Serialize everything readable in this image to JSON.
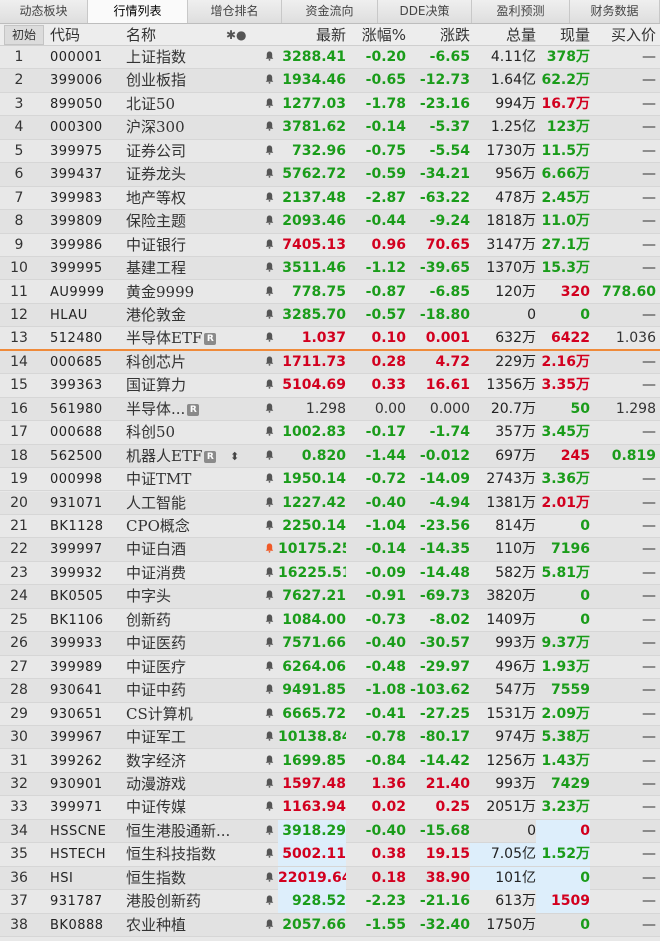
{
  "tabs": [
    "动态板块",
    "行情列表",
    "增仓排名",
    "资金流向",
    "DDE决策",
    "盈利预测",
    "财务数据"
  ],
  "active_tab": 1,
  "header": {
    "init_button": "初始",
    "code": "代码",
    "name": "名称",
    "icons": "✱●",
    "latest": "最新",
    "pct": "涨幅%",
    "chg": "涨跌",
    "volume": "总量",
    "current": "现量",
    "bid": "买入价"
  },
  "colors": {
    "up": "#d2001f",
    "down": "#1a9c1a",
    "separator": "#ef8a3a",
    "highlight": "#ddeefb"
  },
  "rows": [
    {
      "no": "1",
      "code": "000001",
      "name": "上证指数",
      "latest": "3288.41",
      "pct": "-0.20",
      "chg": "-6.65",
      "vol": "4.11亿",
      "cur": "378万",
      "bid": "—",
      "dir": "dn",
      "cur_dir": "dn"
    },
    {
      "no": "2",
      "code": "399006",
      "name": "创业板指",
      "latest": "1934.46",
      "pct": "-0.65",
      "chg": "-12.73",
      "vol": "1.64亿",
      "cur": "62.2万",
      "bid": "—",
      "dir": "dn",
      "cur_dir": "dn"
    },
    {
      "no": "3",
      "code": "899050",
      "name": "北证50",
      "latest": "1277.03",
      "pct": "-1.78",
      "chg": "-23.16",
      "vol": "994万",
      "cur": "16.7万",
      "bid": "—",
      "dir": "dn",
      "cur_dir": "up"
    },
    {
      "no": "4",
      "code": "000300",
      "name": "沪深300",
      "latest": "3781.62",
      "pct": "-0.14",
      "chg": "-5.37",
      "vol": "1.25亿",
      "cur": "123万",
      "bid": "—",
      "dir": "dn",
      "cur_dir": "dn"
    },
    {
      "no": "5",
      "code": "399975",
      "name": "证券公司",
      "latest": "732.96",
      "pct": "-0.75",
      "chg": "-5.54",
      "vol": "1730万",
      "cur": "11.5万",
      "bid": "—",
      "dir": "dn",
      "cur_dir": "dn"
    },
    {
      "no": "6",
      "code": "399437",
      "name": "证券龙头",
      "latest": "5762.72",
      "pct": "-0.59",
      "chg": "-34.21",
      "vol": "956万",
      "cur": "6.66万",
      "bid": "—",
      "dir": "dn",
      "cur_dir": "dn"
    },
    {
      "no": "7",
      "code": "399983",
      "name": "地产等权",
      "latest": "2137.48",
      "pct": "-2.87",
      "chg": "-63.22",
      "vol": "478万",
      "cur": "2.45万",
      "bid": "—",
      "dir": "dn",
      "cur_dir": "dn"
    },
    {
      "no": "8",
      "code": "399809",
      "name": "保险主题",
      "latest": "2093.46",
      "pct": "-0.44",
      "chg": "-9.24",
      "vol": "1818万",
      "cur": "11.0万",
      "bid": "—",
      "dir": "dn",
      "cur_dir": "dn"
    },
    {
      "no": "9",
      "code": "399986",
      "name": "中证银行",
      "latest": "7405.13",
      "pct": "0.96",
      "chg": "70.65",
      "vol": "3147万",
      "cur": "27.1万",
      "bid": "—",
      "dir": "up",
      "cur_dir": "dn"
    },
    {
      "no": "10",
      "code": "399995",
      "name": "基建工程",
      "latest": "3511.46",
      "pct": "-1.12",
      "chg": "-39.65",
      "vol": "1370万",
      "cur": "15.3万",
      "bid": "—",
      "dir": "dn",
      "cur_dir": "dn"
    },
    {
      "no": "11",
      "code": "AU9999",
      "name": "黄金9999",
      "latest": "778.75",
      "pct": "-0.87",
      "chg": "-6.85",
      "vol": "120万",
      "cur": "320",
      "bid": "778.60",
      "dir": "dn",
      "cur_dir": "up",
      "bid_dir": "dn"
    },
    {
      "no": "12",
      "code": "HLAU",
      "name": "港伦敦金",
      "latest": "3285.70",
      "pct": "-0.57",
      "chg": "-18.80",
      "vol": "0",
      "cur": "0",
      "bid": "—",
      "dir": "dn",
      "cur_dir": "dn"
    },
    {
      "no": "13",
      "code": "512480",
      "name": "半导体ETF",
      "badge": "R",
      "latest": "1.037",
      "pct": "0.10",
      "chg": "0.001",
      "vol": "632万",
      "cur": "6422",
      "bid": "1.036",
      "dir": "up",
      "cur_dir": "up",
      "bid_dir": "fl",
      "sep": true
    },
    {
      "no": "14",
      "code": "000685",
      "name": "科创芯片",
      "latest": "1711.73",
      "pct": "0.28",
      "chg": "4.72",
      "vol": "229万",
      "cur": "2.16万",
      "bid": "—",
      "dir": "up",
      "cur_dir": "up"
    },
    {
      "no": "15",
      "code": "399363",
      "name": "国证算力",
      "latest": "5104.69",
      "pct": "0.33",
      "chg": "16.61",
      "vol": "1356万",
      "cur": "3.35万",
      "bid": "—",
      "dir": "up",
      "cur_dir": "up"
    },
    {
      "no": "16",
      "code": "561980",
      "name": "半导体...",
      "badge": "R",
      "latest": "1.298",
      "pct": "0.00",
      "chg": "0.000",
      "vol": "20.7万",
      "cur": "50",
      "bid": "1.298",
      "dir": "fl",
      "cur_dir": "dn",
      "bid_dir": "fl"
    },
    {
      "no": "17",
      "code": "000688",
      "name": "科创50",
      "latest": "1002.83",
      "pct": "-0.17",
      "chg": "-1.74",
      "vol": "357万",
      "cur": "3.45万",
      "bid": "—",
      "dir": "dn",
      "cur_dir": "dn"
    },
    {
      "no": "18",
      "code": "562500",
      "name": "机器人ETF",
      "badge": "R",
      "extra": "⬍",
      "latest": "0.820",
      "pct": "-1.44",
      "chg": "-0.012",
      "vol": "697万",
      "cur": "245",
      "bid": "0.819",
      "dir": "dn",
      "cur_dir": "up",
      "bid_dir": "dn"
    },
    {
      "no": "19",
      "code": "000998",
      "name": "中证TMT",
      "latest": "1950.14",
      "pct": "-0.72",
      "chg": "-14.09",
      "vol": "2743万",
      "cur": "3.36万",
      "bid": "—",
      "dir": "dn",
      "cur_dir": "dn"
    },
    {
      "no": "20",
      "code": "931071",
      "name": "人工智能",
      "latest": "1227.42",
      "pct": "-0.40",
      "chg": "-4.94",
      "vol": "1381万",
      "cur": "2.01万",
      "bid": "—",
      "dir": "dn",
      "cur_dir": "up"
    },
    {
      "no": "21",
      "code": "BK1128",
      "name": "CPO概念",
      "latest": "2250.14",
      "pct": "-1.04",
      "chg": "-23.56",
      "vol": "814万",
      "cur": "0",
      "bid": "—",
      "dir": "dn",
      "cur_dir": "dn"
    },
    {
      "no": "22",
      "code": "399997",
      "name": "中证白酒",
      "latest": "10175.25",
      "pct": "-0.14",
      "chg": "-14.35",
      "vol": "110万",
      "cur": "7196",
      "bid": "—",
      "dir": "dn",
      "cur_dir": "dn",
      "bell_active": true
    },
    {
      "no": "23",
      "code": "399932",
      "name": "中证消费",
      "latest": "16225.51",
      "pct": "-0.09",
      "chg": "-14.48",
      "vol": "582万",
      "cur": "5.81万",
      "bid": "—",
      "dir": "dn",
      "cur_dir": "dn"
    },
    {
      "no": "24",
      "code": "BK0505",
      "name": "中字头",
      "latest": "7627.21",
      "pct": "-0.91",
      "chg": "-69.73",
      "vol": "3820万",
      "cur": "0",
      "bid": "—",
      "dir": "dn",
      "cur_dir": "dn"
    },
    {
      "no": "25",
      "code": "BK1106",
      "name": "创新药",
      "latest": "1084.00",
      "pct": "-0.73",
      "chg": "-8.02",
      "vol": "1409万",
      "cur": "0",
      "bid": "—",
      "dir": "dn",
      "cur_dir": "dn"
    },
    {
      "no": "26",
      "code": "399933",
      "name": "中证医药",
      "latest": "7571.66",
      "pct": "-0.40",
      "chg": "-30.57",
      "vol": "993万",
      "cur": "9.37万",
      "bid": "—",
      "dir": "dn",
      "cur_dir": "dn"
    },
    {
      "no": "27",
      "code": "399989",
      "name": "中证医疗",
      "latest": "6264.06",
      "pct": "-0.48",
      "chg": "-29.97",
      "vol": "496万",
      "cur": "1.93万",
      "bid": "—",
      "dir": "dn",
      "cur_dir": "dn"
    },
    {
      "no": "28",
      "code": "930641",
      "name": "中证中药",
      "latest": "9491.85",
      "pct": "-1.08",
      "chg": "-103.62",
      "vol": "547万",
      "cur": "7559",
      "bid": "—",
      "dir": "dn",
      "cur_dir": "dn"
    },
    {
      "no": "29",
      "code": "930651",
      "name": "CS计算机",
      "latest": "6665.72",
      "pct": "-0.41",
      "chg": "-27.25",
      "vol": "1531万",
      "cur": "2.09万",
      "bid": "—",
      "dir": "dn",
      "cur_dir": "dn"
    },
    {
      "no": "30",
      "code": "399967",
      "name": "中证军工",
      "latest": "10138.84",
      "pct": "-0.78",
      "chg": "-80.17",
      "vol": "974万",
      "cur": "5.38万",
      "bid": "—",
      "dir": "dn",
      "cur_dir": "dn"
    },
    {
      "no": "31",
      "code": "399262",
      "name": "数字经济",
      "latest": "1699.85",
      "pct": "-0.84",
      "chg": "-14.42",
      "vol": "1256万",
      "cur": "1.43万",
      "bid": "—",
      "dir": "dn",
      "cur_dir": "dn"
    },
    {
      "no": "32",
      "code": "930901",
      "name": "动漫游戏",
      "latest": "1597.48",
      "pct": "1.36",
      "chg": "21.40",
      "vol": "993万",
      "cur": "7429",
      "bid": "—",
      "dir": "up",
      "cur_dir": "dn"
    },
    {
      "no": "33",
      "code": "399971",
      "name": "中证传媒",
      "latest": "1163.94",
      "pct": "0.02",
      "chg": "0.25",
      "vol": "2051万",
      "cur": "3.23万",
      "bid": "—",
      "dir": "up",
      "cur_dir": "dn"
    },
    {
      "no": "34",
      "code": "HSSCNE",
      "name": "恒生港股通新...",
      "latest": "3918.29",
      "pct": "-0.40",
      "chg": "-15.68",
      "vol": "0",
      "cur": "0",
      "bid": "—",
      "dir": "dn",
      "cur_dir": "up",
      "hl_latest": true,
      "hl_cur": true
    },
    {
      "no": "35",
      "code": "HSTECH",
      "name": "恒生科技指数",
      "latest": "5002.11",
      "pct": "0.38",
      "chg": "19.15",
      "vol": "7.05亿",
      "cur": "1.52万",
      "bid": "—",
      "dir": "up",
      "cur_dir": "dn",
      "hl_latest": true,
      "hl_vol": true,
      "hl_cur": true
    },
    {
      "no": "36",
      "code": "HSI",
      "name": "恒生指数",
      "latest": "22019.64",
      "pct": "0.18",
      "chg": "38.90",
      "vol": "101亿",
      "cur": "0",
      "bid": "—",
      "dir": "up",
      "cur_dir": "dn",
      "hl_latest": true,
      "hl_vol": true,
      "hl_cur": true
    },
    {
      "no": "37",
      "code": "931787",
      "name": "港股创新药",
      "latest": "928.52",
      "pct": "-2.23",
      "chg": "-21.16",
      "vol": "613万",
      "cur": "1509",
      "bid": "—",
      "dir": "dn",
      "cur_dir": "up",
      "hl_latest": true,
      "hl_cur": true
    },
    {
      "no": "38",
      "code": "BK0888",
      "name": "农业种植",
      "latest": "2057.66",
      "pct": "-1.55",
      "chg": "-32.40",
      "vol": "1750万",
      "cur": "0",
      "bid": "—",
      "dir": "dn",
      "cur_dir": "dn"
    }
  ]
}
